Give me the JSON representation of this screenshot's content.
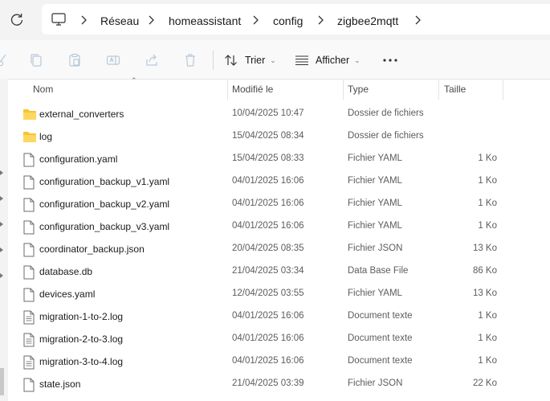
{
  "breadcrumb": [
    "Réseau",
    "homeassistant",
    "config",
    "zigbee2mqtt"
  ],
  "toolbar": {
    "sort_label": "Trier",
    "view_label": "Afficher"
  },
  "columns": {
    "name": "Nom",
    "modified": "Modifié le",
    "type": "Type",
    "size": "Taille"
  },
  "files": [
    {
      "name": "external_converters",
      "date": "10/04/2025 10:47",
      "type": "Dossier de fichiers",
      "size": "",
      "icon": "folder-icon"
    },
    {
      "name": "log",
      "date": "15/04/2025 08:34",
      "type": "Dossier de fichiers",
      "size": "",
      "icon": "folder-icon"
    },
    {
      "name": "configuration.yaml",
      "date": "15/04/2025 08:33",
      "type": "Fichier YAML",
      "size": "1 Ko",
      "icon": "file-icon"
    },
    {
      "name": "configuration_backup_v1.yaml",
      "date": "04/01/2025 16:06",
      "type": "Fichier YAML",
      "size": "1 Ko",
      "icon": "file-icon"
    },
    {
      "name": "configuration_backup_v2.yaml",
      "date": "04/01/2025 16:06",
      "type": "Fichier YAML",
      "size": "1 Ko",
      "icon": "file-icon"
    },
    {
      "name": "configuration_backup_v3.yaml",
      "date": "04/01/2025 16:06",
      "type": "Fichier YAML",
      "size": "1 Ko",
      "icon": "file-icon"
    },
    {
      "name": "coordinator_backup.json",
      "date": "20/04/2025 08:35",
      "type": "Fichier JSON",
      "size": "13 Ko",
      "icon": "file-icon"
    },
    {
      "name": "database.db",
      "date": "21/04/2025 03:34",
      "type": "Data Base File",
      "size": "86 Ko",
      "icon": "file-icon"
    },
    {
      "name": "devices.yaml",
      "date": "12/04/2025 03:55",
      "type": "Fichier YAML",
      "size": "13 Ko",
      "icon": "file-icon"
    },
    {
      "name": "migration-1-to-2.log",
      "date": "04/01/2025 16:06",
      "type": "Document texte",
      "size": "1 Ko",
      "icon": "text-file-icon"
    },
    {
      "name": "migration-2-to-3.log",
      "date": "04/01/2025 16:06",
      "type": "Document texte",
      "size": "1 Ko",
      "icon": "text-file-icon"
    },
    {
      "name": "migration-3-to-4.log",
      "date": "04/01/2025 16:06",
      "type": "Document texte",
      "size": "1 Ko",
      "icon": "text-file-icon"
    },
    {
      "name": "state.json",
      "date": "21/04/2025 03:39",
      "type": "Fichier JSON",
      "size": "22 Ko",
      "icon": "file-icon"
    }
  ]
}
